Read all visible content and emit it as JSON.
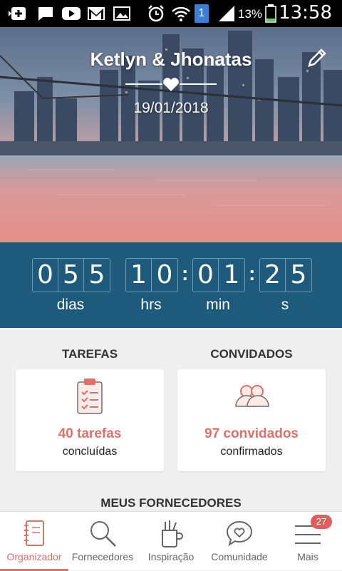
{
  "status_bar": {
    "time": "13:58",
    "battery_percent": "13%",
    "notification_count": "1"
  },
  "hero": {
    "couple_names": "Ketlyn & Jhonatas",
    "wedding_date": "19/01/2018"
  },
  "countdown": {
    "days": [
      "0",
      "5",
      "5"
    ],
    "hours": [
      "1",
      "0"
    ],
    "minutes": [
      "0",
      "1"
    ],
    "seconds": [
      "2",
      "5"
    ],
    "days_label": "dias",
    "hours_label": "hrs",
    "minutes_label": "min",
    "seconds_label": "s"
  },
  "tasks": {
    "title": "TAREFAS",
    "count_text": "40 tarefas",
    "sub_text": "concluídas"
  },
  "guests": {
    "title": "CONVIDADOS",
    "count_text": "97 convidados",
    "sub_text": "confirmados"
  },
  "vendors": {
    "title": "MEUS FORNECEDORES"
  },
  "tabbar": {
    "tabs": [
      {
        "label": "Organizador",
        "icon": "notebook-icon",
        "active": true
      },
      {
        "label": "Fornecedores",
        "icon": "search-icon",
        "active": false
      },
      {
        "label": "Inspiração",
        "icon": "pencil-cup-icon",
        "active": false
      },
      {
        "label": "Comunidade",
        "icon": "chat-heart-icon",
        "active": false
      },
      {
        "label": "Mais",
        "icon": "menu-icon",
        "active": false
      }
    ],
    "more_badge": "27"
  },
  "colors": {
    "accent": "#e0706a",
    "countdown_bg": "#1d5a7c",
    "page_bg": "#efefef"
  }
}
